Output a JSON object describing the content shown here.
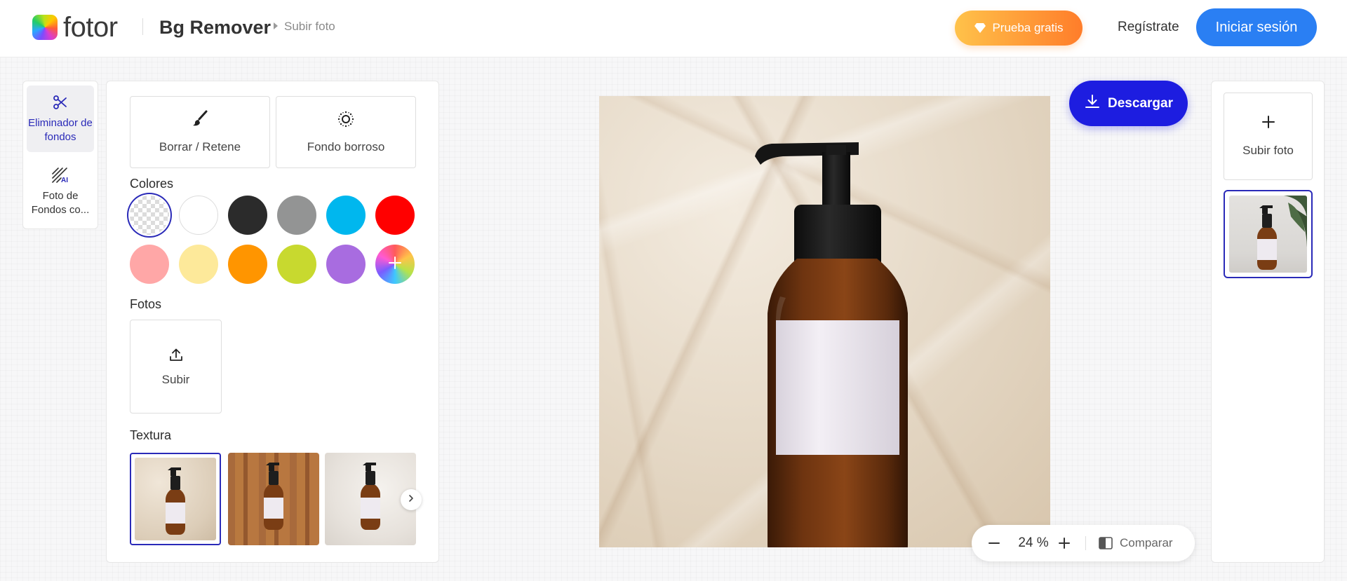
{
  "header": {
    "logo_text": "fotor",
    "app_title": "Bg Remover",
    "breadcrumb": "Subir foto",
    "trial_label": "Prueba gratis",
    "register_label": "Regístrate",
    "login_label": "Iniciar sesión"
  },
  "tool_rail": {
    "items": [
      {
        "label": "Eliminador de fondos",
        "icon": "scissors-icon",
        "active": true
      },
      {
        "label": "Foto de Fondos co...",
        "icon": "ai-background-icon",
        "active": false
      }
    ]
  },
  "options": {
    "modes": [
      {
        "label": "Borrar / Retene",
        "icon": "brush-icon"
      },
      {
        "label": "Fondo borroso",
        "icon": "blur-icon"
      }
    ],
    "colors_label": "Colores",
    "colors": [
      {
        "name": "transparent",
        "hex": "transparent",
        "selected": true
      },
      {
        "name": "white",
        "hex": "#ffffff"
      },
      {
        "name": "black",
        "hex": "#2b2b2b"
      },
      {
        "name": "gray",
        "hex": "#939494"
      },
      {
        "name": "cyan",
        "hex": "#00b7ee"
      },
      {
        "name": "red",
        "hex": "#ff0000"
      },
      {
        "name": "pink",
        "hex": "#ffa7a7"
      },
      {
        "name": "light-yellow",
        "hex": "#fde99a"
      },
      {
        "name": "orange",
        "hex": "#ff9500"
      },
      {
        "name": "lime",
        "hex": "#c8d92f"
      },
      {
        "name": "purple",
        "hex": "#a86ce0"
      },
      {
        "name": "custom",
        "hex": "gradient"
      }
    ],
    "photos_label": "Fotos",
    "upload_label": "Subir",
    "texture_label": "Textura",
    "textures": [
      {
        "name": "paper",
        "selected": true
      },
      {
        "name": "wood"
      },
      {
        "name": "stone"
      }
    ]
  },
  "canvas": {
    "download_label": "Descargar",
    "zoom_value": "24 %",
    "compare_label": "Comparar"
  },
  "right_panel": {
    "upload_photo_label": "Subir foto"
  },
  "colors": {
    "accent": "#1d1de0",
    "login": "#2a7ff3",
    "trial_start": "#ffc24a",
    "trial_end": "#ff7d2a",
    "selection": "#2a2ab8"
  }
}
